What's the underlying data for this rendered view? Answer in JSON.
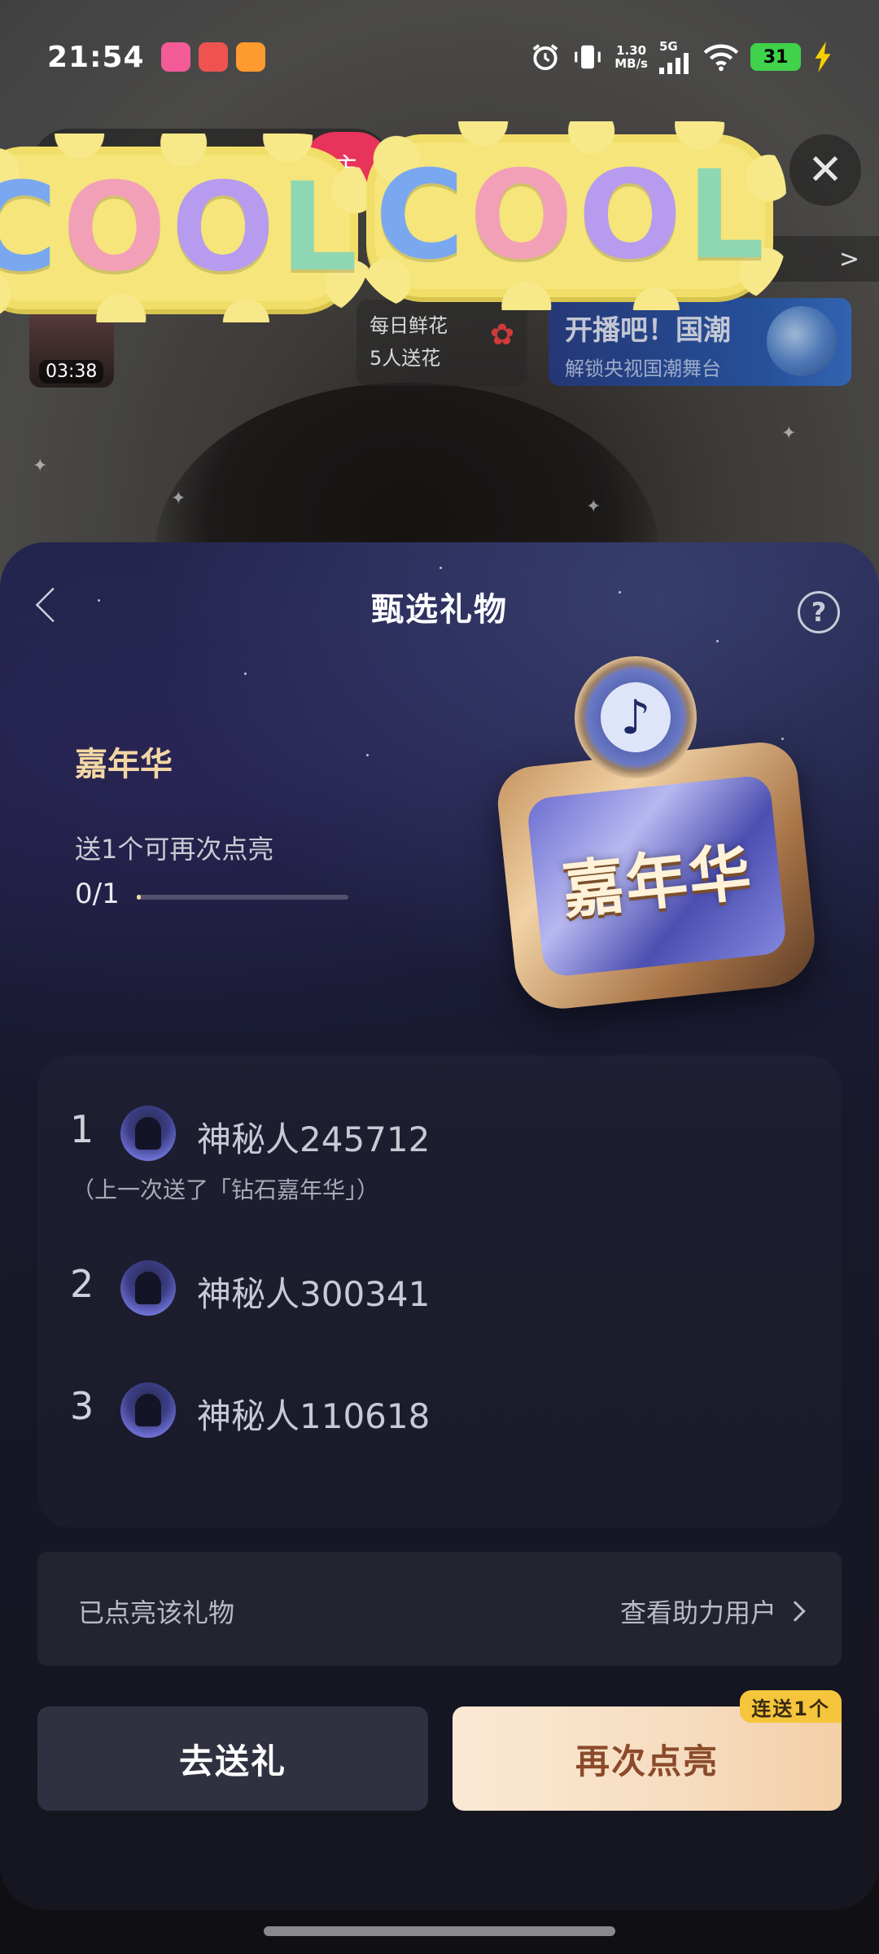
{
  "status_bar": {
    "time": "21:54",
    "net_speed_value": "1.30",
    "net_speed_unit": "MB/s",
    "network": "5G",
    "battery": "31",
    "icons": [
      "alarm-icon",
      "vibrate-icon",
      "signal-icon",
      "wifi-icon",
      "battery-icon",
      "charging-icon"
    ]
  },
  "live_room": {
    "follow_label": "主",
    "rank_chevron": ">",
    "timer": "03:38",
    "flower_card": {
      "line1": "每日鲜花",
      "line2": "5人送花"
    },
    "promo_card": {
      "title": "开播吧！国潮",
      "subtitle": "解锁央视国潮舞台"
    },
    "sticker_text": [
      "C",
      "O",
      "O",
      "L"
    ]
  },
  "panel": {
    "title": "甄选礼物",
    "help": "?",
    "gift_name": "嘉年华",
    "hint": "送1个可再次点亮",
    "progress": {
      "current": "0",
      "total": "/1",
      "fraction": 0.0
    },
    "badge_text": "嘉年华",
    "badge_logo": "♪",
    "ranking": [
      {
        "rank": "1",
        "name": "神秘人245712",
        "note": "（上一次送了「钻石嘉年华」）"
      },
      {
        "rank": "2",
        "name": "神秘人300341",
        "note": ""
      },
      {
        "rank": "3",
        "name": "神秘人110618",
        "note": ""
      }
    ],
    "lit_label": "已点亮该礼物",
    "lit_link": "查看助力用户",
    "send_button": "去送礼",
    "relight_button": "再次点亮",
    "combo_tag": "连送1个"
  },
  "colors": {
    "accent_gold": "#f3d7a4",
    "relight_text": "#8b4b2b",
    "combo_tag": "#f5c63b",
    "battery": "#3fd24a"
  }
}
